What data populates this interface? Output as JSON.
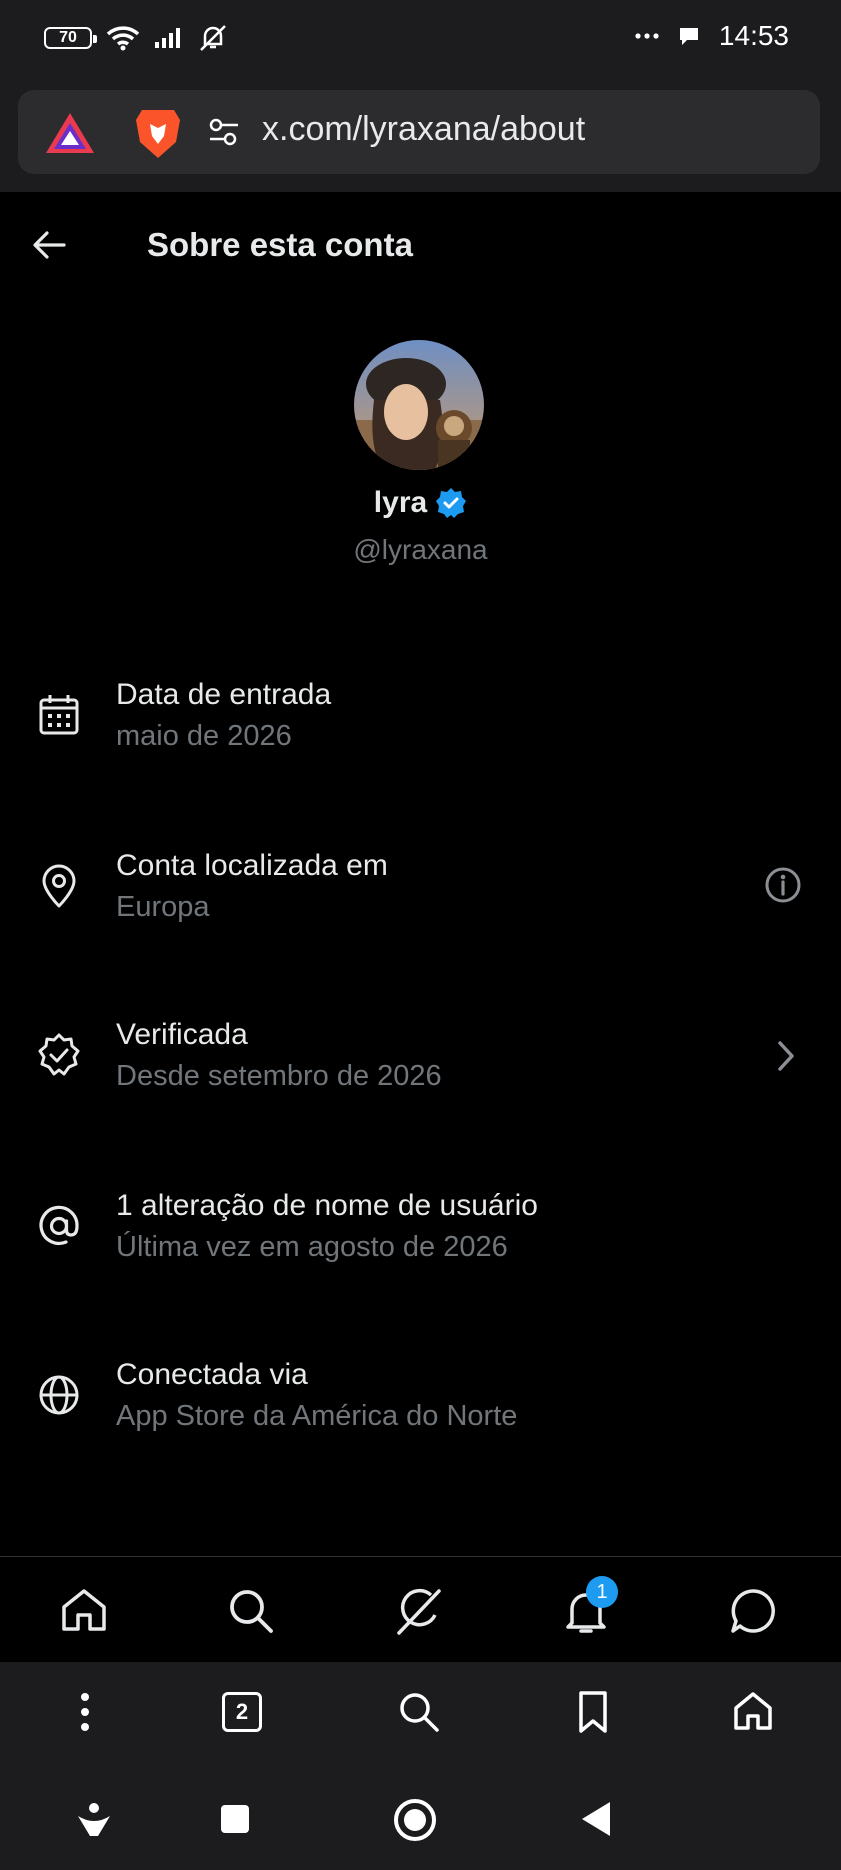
{
  "status_bar": {
    "battery": "70",
    "time": "14:53",
    "icons": [
      "wifi-icon",
      "signal-icon",
      "alarm-off-icon",
      "more-dots-icon",
      "chat-bubble-icon"
    ]
  },
  "browser": {
    "url": "x.com/lyraxana/about",
    "tab_count": "2"
  },
  "header": {
    "title": "Sobre esta conta"
  },
  "profile": {
    "name": "lyra",
    "handle": "@lyraxana",
    "verified_color": "#1d9bf0"
  },
  "details": [
    {
      "label": "Data de entrada",
      "value": "maio de 2026",
      "icon": "calendar-icon"
    },
    {
      "label": "Conta localizada em",
      "value": "Europa",
      "icon": "location-pin-icon"
    },
    {
      "label": "Verificada",
      "value": "Desde setembro de 2026",
      "icon": "verified-badge-icon"
    },
    {
      "label": "1 alteração de nome de usuário",
      "value": "Última vez em agosto de 2026",
      "icon": "at-sign-icon"
    },
    {
      "label": "Conectada via",
      "value": "App Store da América do Norte",
      "icon": "globe-icon"
    }
  ],
  "tabbar": {
    "notifications_badge": "1",
    "items": [
      "home-icon",
      "search-icon",
      "grok-icon",
      "notifications-icon",
      "messages-icon"
    ]
  },
  "colors": {
    "background": "#000000",
    "text_primary": "#e7e9ea",
    "text_secondary": "#71767b",
    "accent": "#1d9bf0"
  }
}
